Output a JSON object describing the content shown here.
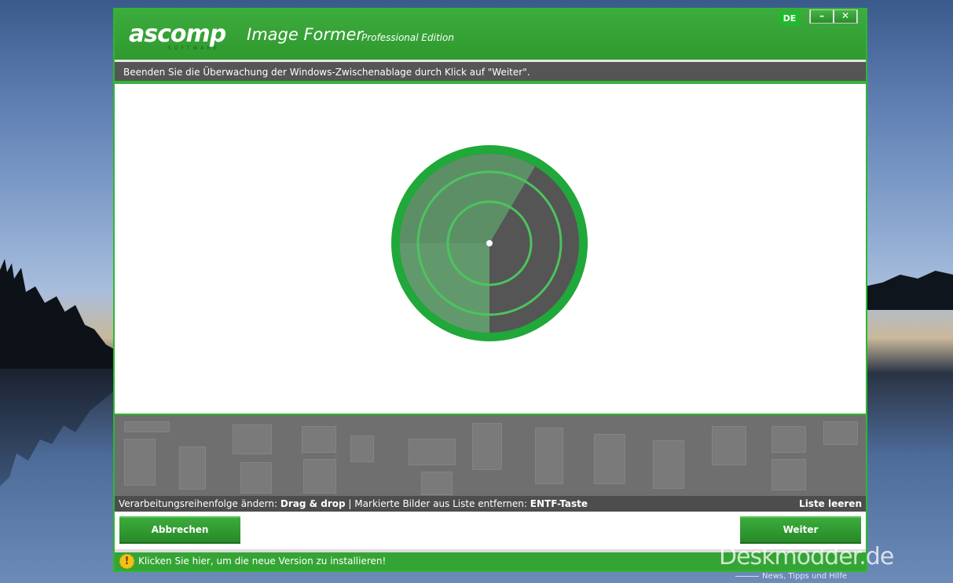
{
  "app": {
    "logo_text": "ascomp",
    "logo_sub": "SOFTWARE",
    "title": "Image Former",
    "edition": "Professional Edition",
    "language": "DE",
    "minimize_label": "–",
    "close_label": "✕"
  },
  "instruction": "Beenden Sie die Überwachung der Windows-Zwischenablage durch Klick auf \"Weiter\".",
  "info_bar": {
    "order_label": "Verarbeitungsreihenfolge ändern:",
    "order_action": "Drag & drop",
    "separator": "|",
    "remove_label": "Markierte Bilder aus Liste entfernen:",
    "remove_action": "ENTF-Taste",
    "clear_list": "Liste leeren"
  },
  "buttons": {
    "cancel": "Abbrechen",
    "next": "Weiter"
  },
  "update_notice": "Klicken Sie hier, um die neue Version zu installieren!",
  "watermark": {
    "name": "Deskmodder.de",
    "tagline": "News, Tipps und Hilfe"
  },
  "colors": {
    "accent": "#2db82d",
    "header": "#34a534",
    "dark_bar": "#555555",
    "radar_ring": "#20a83a",
    "radar_body": "#555555",
    "radar_sweep": "#5f9a6a"
  },
  "icons": {
    "warning": "warning-icon",
    "radar": "radar-scanner-icon"
  }
}
